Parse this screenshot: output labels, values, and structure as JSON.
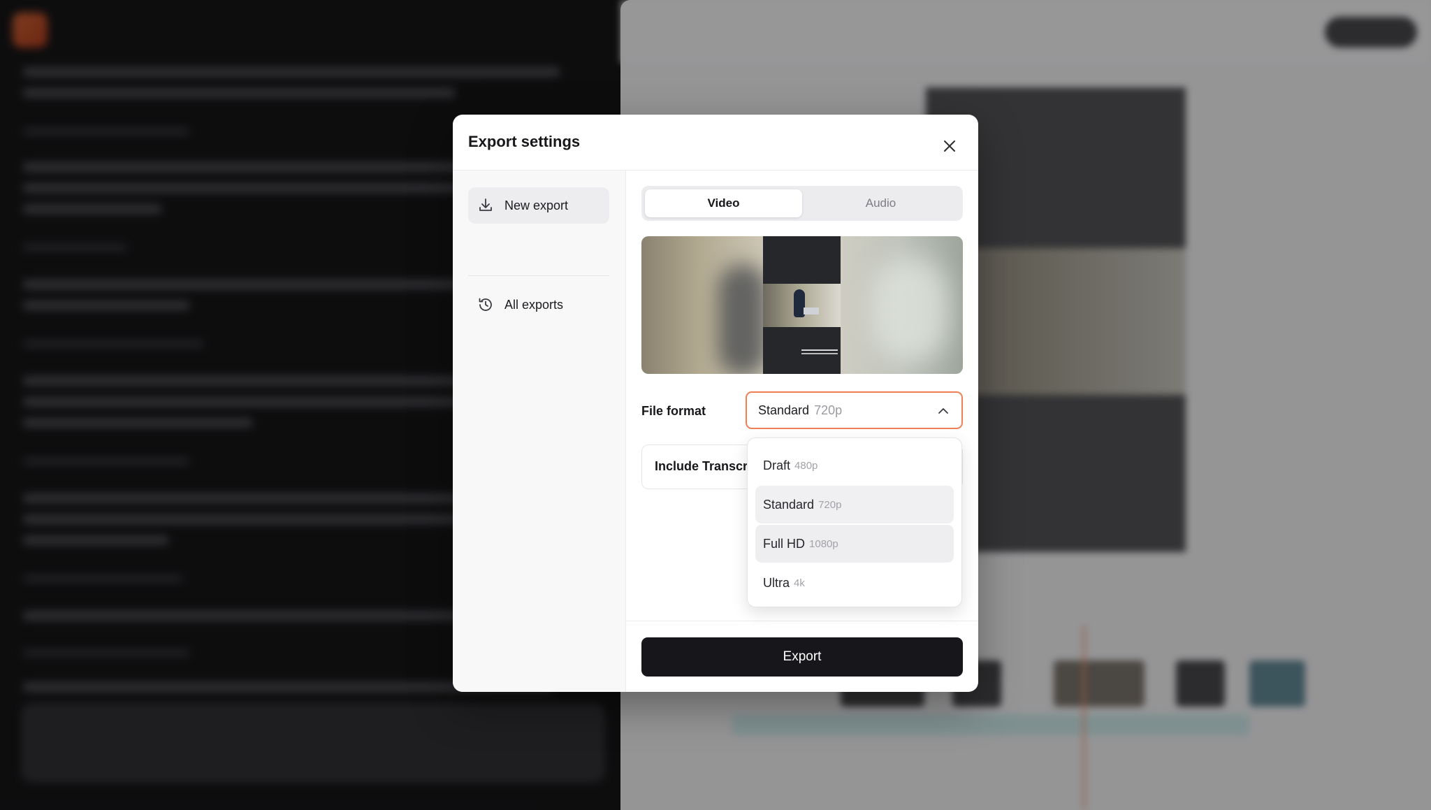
{
  "modal": {
    "title": "Export settings"
  },
  "sidebar": {
    "items": [
      {
        "label": "New export"
      },
      {
        "label": "All exports"
      }
    ]
  },
  "tabs": [
    {
      "label": "Video",
      "active": true
    },
    {
      "label": "Audio",
      "active": false
    }
  ],
  "file_format": {
    "label": "File format",
    "selected_name": "Standard",
    "selected_res": "720p",
    "options": [
      {
        "name": "Draft",
        "res": "480p"
      },
      {
        "name": "Standard",
        "res": "720p"
      },
      {
        "name": "Full HD",
        "res": "1080p"
      },
      {
        "name": "Ultra",
        "res": "4k"
      }
    ]
  },
  "transcript": {
    "label": "Include Transcri"
  },
  "export_button": {
    "label": "Export"
  },
  "colors": {
    "accent_border": "#f07f55",
    "primary_button": "#17171b"
  }
}
